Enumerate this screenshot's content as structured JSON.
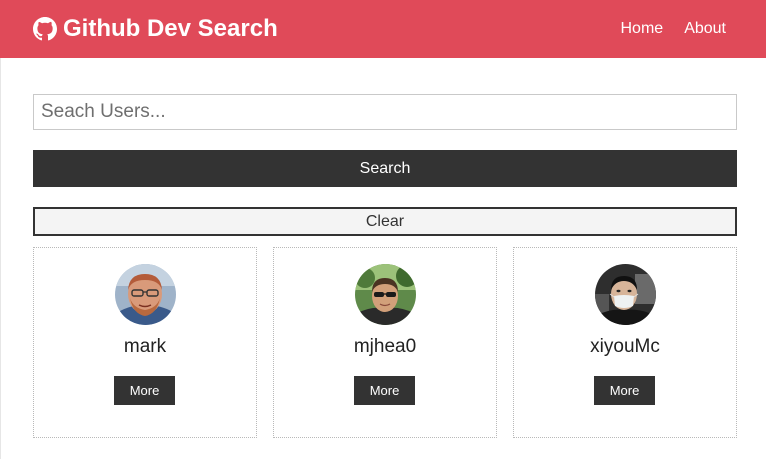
{
  "navbar": {
    "brand_icon": "github-icon",
    "brand_title": "Github Dev Search",
    "links": [
      {
        "label": "Home"
      },
      {
        "label": "About"
      }
    ],
    "background": "#e04a59"
  },
  "search": {
    "placeholder": "Seach Users...",
    "value": "",
    "search_label": "Search",
    "clear_label": "Clear"
  },
  "users": [
    {
      "login": "mark",
      "more_label": "More"
    },
    {
      "login": "mjhea0",
      "more_label": "More"
    },
    {
      "login": "xiyouMc",
      "more_label": "More"
    }
  ],
  "colors": {
    "accent": "#e04a59",
    "dark_button": "#333333",
    "light_button": "#f4f4f4"
  }
}
